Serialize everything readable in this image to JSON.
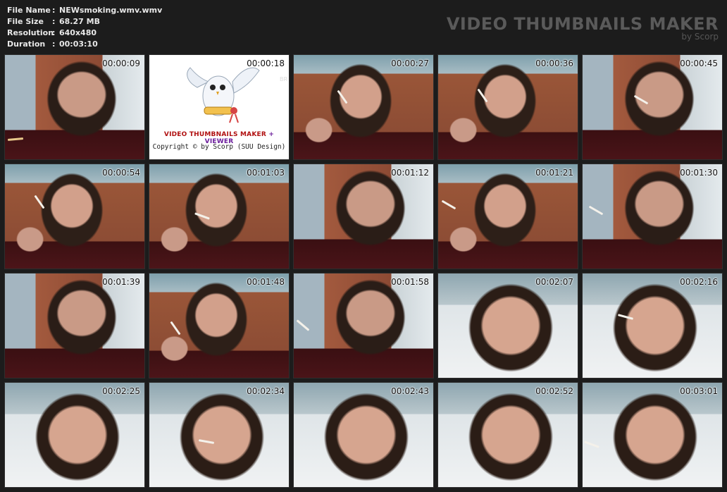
{
  "file_info": {
    "rows": [
      {
        "key": "File Name",
        "value": "NEWsmoking.wmv.wmv"
      },
      {
        "key": "File Size",
        "value": "68.27 MB"
      },
      {
        "key": "Resolution",
        "value": "640x480"
      },
      {
        "key": "Duration",
        "value": "00:03:10"
      }
    ],
    "separator": ":"
  },
  "brand": {
    "title": "VIDEO THUMBNAILS MAKER",
    "subtitle": "by Scorp"
  },
  "logo_tile": {
    "title_part1": "VIDEO THUMBNAILS MAKER",
    "title_part2": " + VIEWER",
    "copyright": "Copyright © by Scorp (SUU Design)",
    "ghost_text": "BR"
  },
  "thumbnails": [
    {
      "time": "00:00:09"
    },
    {
      "time": "00:00:18"
    },
    {
      "time": "00:00:27"
    },
    {
      "time": "00:00:36"
    },
    {
      "time": "00:00:45"
    },
    {
      "time": "00:00:54"
    },
    {
      "time": "00:01:03"
    },
    {
      "time": "00:01:12"
    },
    {
      "time": "00:01:21"
    },
    {
      "time": "00:01:30"
    },
    {
      "time": "00:01:39"
    },
    {
      "time": "00:01:48"
    },
    {
      "time": "00:01:58"
    },
    {
      "time": "00:02:07"
    },
    {
      "time": "00:02:16"
    },
    {
      "time": "00:02:25"
    },
    {
      "time": "00:02:34"
    },
    {
      "time": "00:02:43"
    },
    {
      "time": "00:02:52"
    },
    {
      "time": "00:03:01"
    }
  ]
}
